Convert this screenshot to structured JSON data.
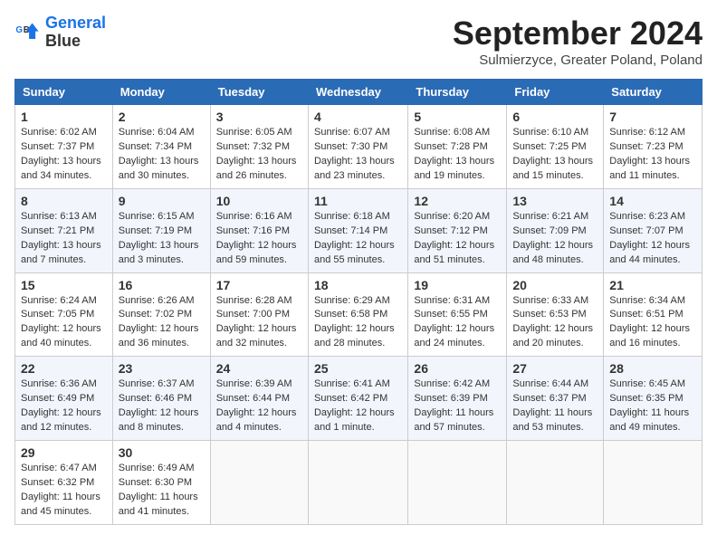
{
  "header": {
    "logo_line1": "General",
    "logo_line2": "Blue",
    "month": "September 2024",
    "location": "Sulmierzyce, Greater Poland, Poland"
  },
  "weekdays": [
    "Sunday",
    "Monday",
    "Tuesday",
    "Wednesday",
    "Thursday",
    "Friday",
    "Saturday"
  ],
  "weeks": [
    [
      {
        "day": "1",
        "info": "Sunrise: 6:02 AM\nSunset: 7:37 PM\nDaylight: 13 hours\nand 34 minutes."
      },
      {
        "day": "2",
        "info": "Sunrise: 6:04 AM\nSunset: 7:34 PM\nDaylight: 13 hours\nand 30 minutes."
      },
      {
        "day": "3",
        "info": "Sunrise: 6:05 AM\nSunset: 7:32 PM\nDaylight: 13 hours\nand 26 minutes."
      },
      {
        "day": "4",
        "info": "Sunrise: 6:07 AM\nSunset: 7:30 PM\nDaylight: 13 hours\nand 23 minutes."
      },
      {
        "day": "5",
        "info": "Sunrise: 6:08 AM\nSunset: 7:28 PM\nDaylight: 13 hours\nand 19 minutes."
      },
      {
        "day": "6",
        "info": "Sunrise: 6:10 AM\nSunset: 7:25 PM\nDaylight: 13 hours\nand 15 minutes."
      },
      {
        "day": "7",
        "info": "Sunrise: 6:12 AM\nSunset: 7:23 PM\nDaylight: 13 hours\nand 11 minutes."
      }
    ],
    [
      {
        "day": "8",
        "info": "Sunrise: 6:13 AM\nSunset: 7:21 PM\nDaylight: 13 hours\nand 7 minutes."
      },
      {
        "day": "9",
        "info": "Sunrise: 6:15 AM\nSunset: 7:19 PM\nDaylight: 13 hours\nand 3 minutes."
      },
      {
        "day": "10",
        "info": "Sunrise: 6:16 AM\nSunset: 7:16 PM\nDaylight: 12 hours\nand 59 minutes."
      },
      {
        "day": "11",
        "info": "Sunrise: 6:18 AM\nSunset: 7:14 PM\nDaylight: 12 hours\nand 55 minutes."
      },
      {
        "day": "12",
        "info": "Sunrise: 6:20 AM\nSunset: 7:12 PM\nDaylight: 12 hours\nand 51 minutes."
      },
      {
        "day": "13",
        "info": "Sunrise: 6:21 AM\nSunset: 7:09 PM\nDaylight: 12 hours\nand 48 minutes."
      },
      {
        "day": "14",
        "info": "Sunrise: 6:23 AM\nSunset: 7:07 PM\nDaylight: 12 hours\nand 44 minutes."
      }
    ],
    [
      {
        "day": "15",
        "info": "Sunrise: 6:24 AM\nSunset: 7:05 PM\nDaylight: 12 hours\nand 40 minutes."
      },
      {
        "day": "16",
        "info": "Sunrise: 6:26 AM\nSunset: 7:02 PM\nDaylight: 12 hours\nand 36 minutes."
      },
      {
        "day": "17",
        "info": "Sunrise: 6:28 AM\nSunset: 7:00 PM\nDaylight: 12 hours\nand 32 minutes."
      },
      {
        "day": "18",
        "info": "Sunrise: 6:29 AM\nSunset: 6:58 PM\nDaylight: 12 hours\nand 28 minutes."
      },
      {
        "day": "19",
        "info": "Sunrise: 6:31 AM\nSunset: 6:55 PM\nDaylight: 12 hours\nand 24 minutes."
      },
      {
        "day": "20",
        "info": "Sunrise: 6:33 AM\nSunset: 6:53 PM\nDaylight: 12 hours\nand 20 minutes."
      },
      {
        "day": "21",
        "info": "Sunrise: 6:34 AM\nSunset: 6:51 PM\nDaylight: 12 hours\nand 16 minutes."
      }
    ],
    [
      {
        "day": "22",
        "info": "Sunrise: 6:36 AM\nSunset: 6:49 PM\nDaylight: 12 hours\nand 12 minutes."
      },
      {
        "day": "23",
        "info": "Sunrise: 6:37 AM\nSunset: 6:46 PM\nDaylight: 12 hours\nand 8 minutes."
      },
      {
        "day": "24",
        "info": "Sunrise: 6:39 AM\nSunset: 6:44 PM\nDaylight: 12 hours\nand 4 minutes."
      },
      {
        "day": "25",
        "info": "Sunrise: 6:41 AM\nSunset: 6:42 PM\nDaylight: 12 hours\nand 1 minute."
      },
      {
        "day": "26",
        "info": "Sunrise: 6:42 AM\nSunset: 6:39 PM\nDaylight: 11 hours\nand 57 minutes."
      },
      {
        "day": "27",
        "info": "Sunrise: 6:44 AM\nSunset: 6:37 PM\nDaylight: 11 hours\nand 53 minutes."
      },
      {
        "day": "28",
        "info": "Sunrise: 6:45 AM\nSunset: 6:35 PM\nDaylight: 11 hours\nand 49 minutes."
      }
    ],
    [
      {
        "day": "29",
        "info": "Sunrise: 6:47 AM\nSunset: 6:32 PM\nDaylight: 11 hours\nand 45 minutes."
      },
      {
        "day": "30",
        "info": "Sunrise: 6:49 AM\nSunset: 6:30 PM\nDaylight: 11 hours\nand 41 minutes."
      },
      {
        "day": "",
        "info": ""
      },
      {
        "day": "",
        "info": ""
      },
      {
        "day": "",
        "info": ""
      },
      {
        "day": "",
        "info": ""
      },
      {
        "day": "",
        "info": ""
      }
    ]
  ]
}
